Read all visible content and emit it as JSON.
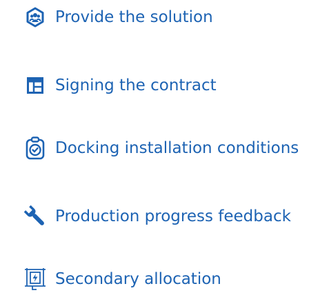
{
  "colors": {
    "accent": "#1d63b3",
    "background": "#ffffff"
  },
  "items": [
    {
      "label": "Provide the solution",
      "icon": "team-hexagon-icon"
    },
    {
      "label": "Signing the contract",
      "icon": "layout-grid-icon"
    },
    {
      "label": "Docking installation conditions",
      "icon": "clipboard-check-icon"
    },
    {
      "label": "Production progress feedback",
      "icon": "wrench-icon"
    },
    {
      "label": "Secondary allocation",
      "icon": "power-cabinet-icon"
    }
  ]
}
